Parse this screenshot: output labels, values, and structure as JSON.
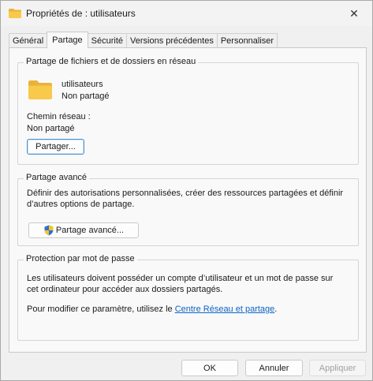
{
  "window": {
    "title": "Propriétés de : utilisateurs",
    "close_symbol": "✕"
  },
  "tabs": [
    {
      "label": "Général",
      "active": false
    },
    {
      "label": "Partage",
      "active": true
    },
    {
      "label": "Sécurité",
      "active": false
    },
    {
      "label": "Versions précédentes",
      "active": false
    },
    {
      "label": "Personnaliser",
      "active": false
    }
  ],
  "network_sharing": {
    "title": "Partage de fichiers et de dossiers en réseau",
    "folder_name": "utilisateurs",
    "folder_status": "Non partagé",
    "path_label": "Chemin réseau :",
    "path_value": "Non partagé",
    "share_button": "Partager..."
  },
  "advanced_sharing": {
    "title": "Partage avancé",
    "description_line1": "Définir des autorisations personnalisées, créer des ressources partagées et définir",
    "description_line2": "d’autres options de partage.",
    "button": "Partage avancé..."
  },
  "password_protection": {
    "title": "Protection par mot de passe",
    "description_line1": "Les utilisateurs doivent posséder un compte d’utilisateur et un mot de passe sur",
    "description_line2": "cet ordinateur pour accéder aux dossiers partagés.",
    "modify_prefix": "Pour modifier ce paramètre, utilisez le ",
    "modify_link": "Centre Réseau et partage",
    "modify_suffix": "."
  },
  "footer": {
    "ok": "OK",
    "cancel": "Annuler",
    "apply": "Appliquer"
  },
  "colors": {
    "accent": "#4a90d9",
    "link": "#0b64c4",
    "folder": "#f8c94b"
  },
  "icons": {
    "title_icon": "folder-icon",
    "share_folder_icon": "folder-icon",
    "advanced_button_icon": "uac-shield-icon",
    "close_icon": "close-icon"
  }
}
